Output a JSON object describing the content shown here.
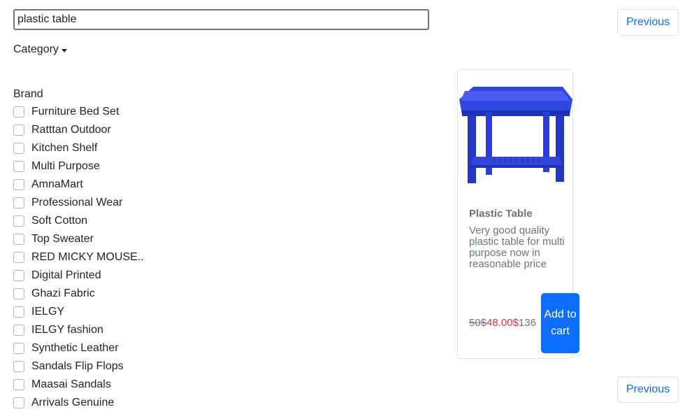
{
  "search": {
    "value": "plastic table"
  },
  "pagination": {
    "previous_label": "Previous"
  },
  "filters": {
    "category_label": "Category",
    "brand_label": "Brand",
    "brands": [
      "Furniture Bed Set",
      "Ratttan Outdoor",
      "Kitchen Shelf",
      "Multi Purpose",
      "AmnaMart",
      "Professional Wear",
      "Soft Cotton",
      "Top Sweater",
      "RED MICKY MOUSE..",
      "Digital Printed",
      "Ghazi Fabric",
      "IELGY",
      "IELGY fashion",
      "Synthetic Leather",
      "Sandals Flip Flops",
      "Maasai Sandals",
      "Arrivals Genuine"
    ]
  },
  "product": {
    "title": "Plastic Table",
    "description": "Very good quality plastic table for multi purpose now in reasonable price",
    "old_price": "50$",
    "new_price": "48.00$",
    "stock": "136",
    "add_label": "Add to cart",
    "image_icon": "blue-plastic-table-image"
  },
  "colors": {
    "accent": "#0d6efd",
    "price": "#dc3545",
    "product_blue": "#2b3fd6"
  }
}
